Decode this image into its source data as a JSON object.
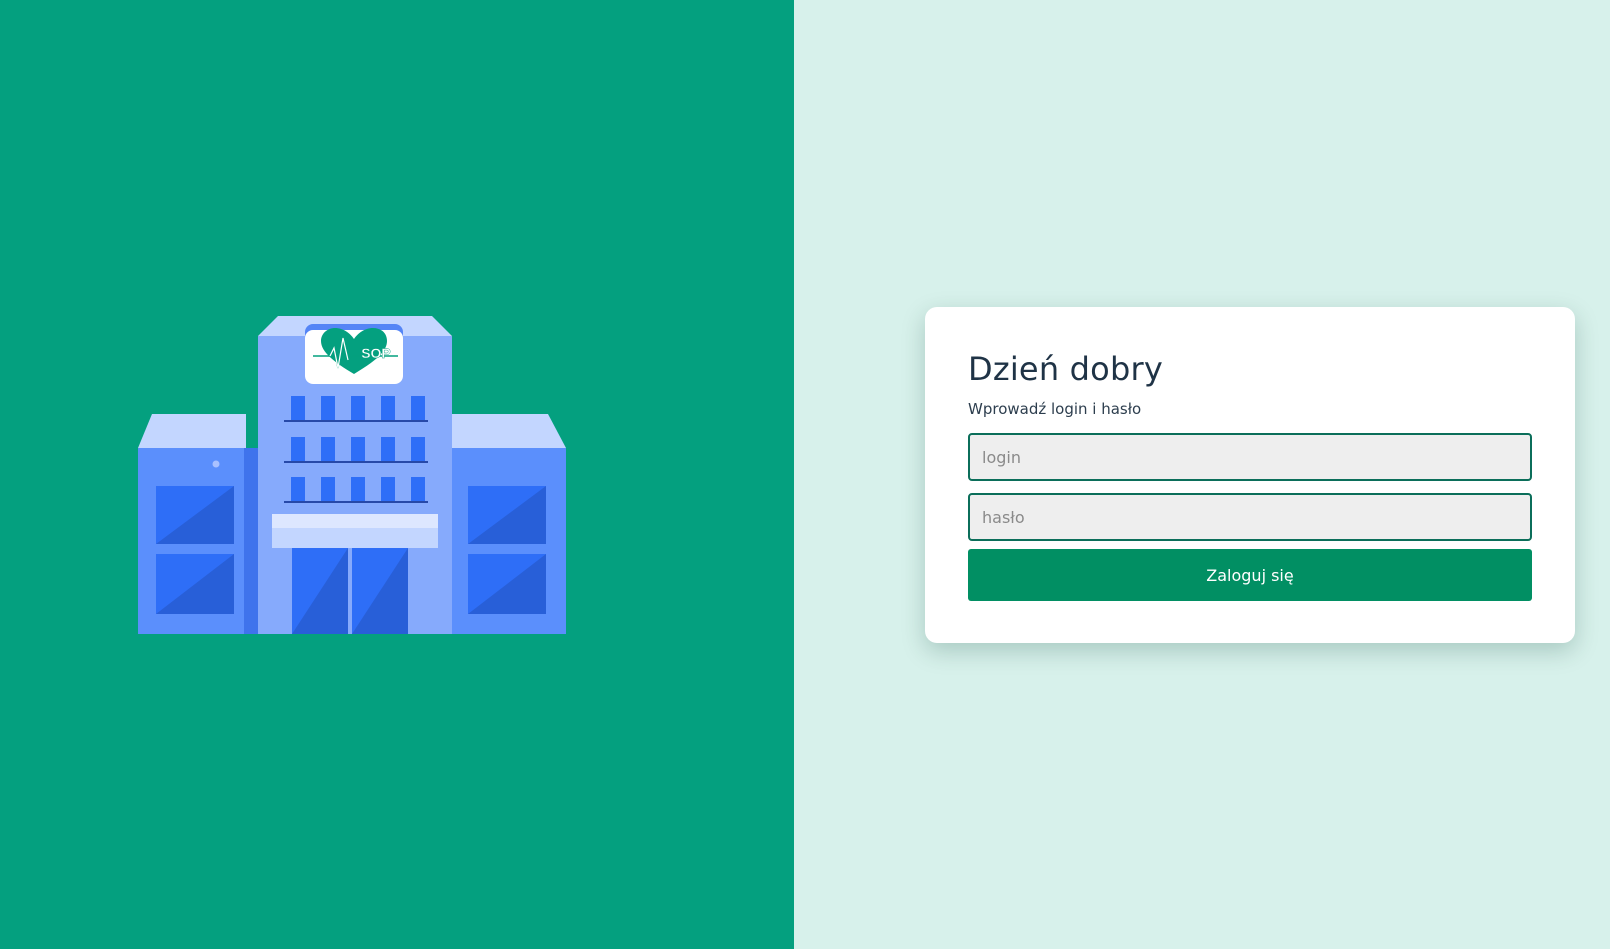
{
  "login_card": {
    "title": "Dzień dobry",
    "subtitle": "Wprowadź login i hasło",
    "login_placeholder": "login",
    "login_value": "",
    "password_placeholder": "hasło",
    "password_value": "",
    "submit_label": "Zaloguj się"
  },
  "illustration": {
    "logo_text": "SOP",
    "icon": "hospital-building-icon"
  },
  "colors": {
    "left_panel": "#04a07f",
    "right_panel": "#d7f1eb",
    "accent_button": "#018f63",
    "field_border": "#0b6e5a",
    "title_text": "#1f3346"
  }
}
